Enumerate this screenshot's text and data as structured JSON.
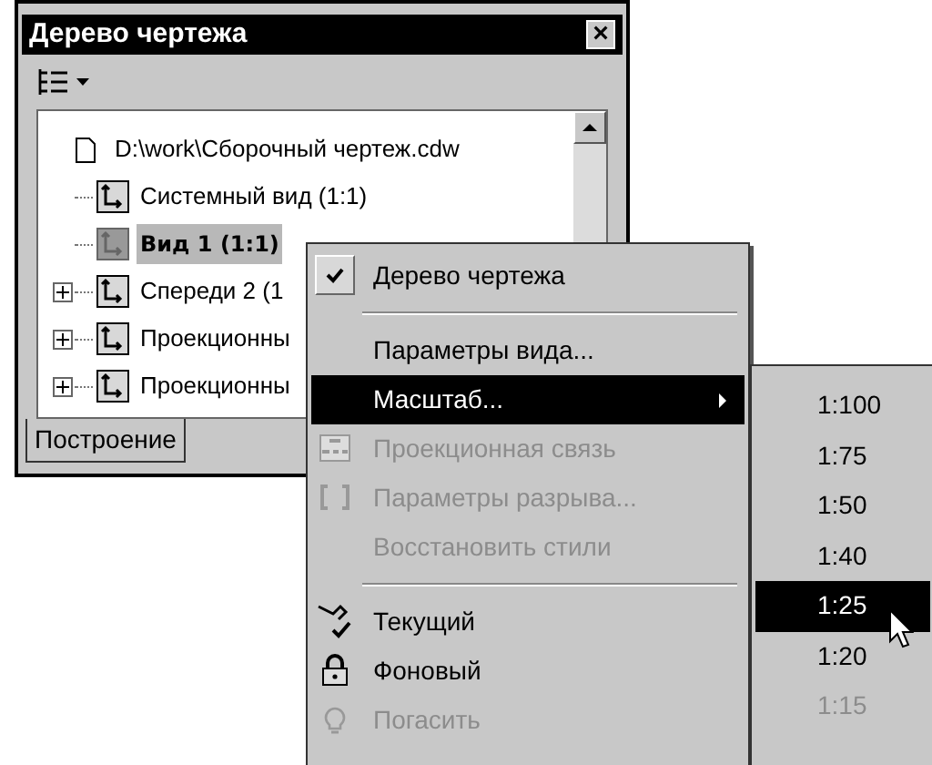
{
  "window": {
    "title": "Дерево чертежа",
    "close_label": "×"
  },
  "tree": {
    "label": "D:\\work\\Сборочный чертеж.cdw",
    "children": [
      {
        "label": "Системный вид (1:1)",
        "selected": false,
        "current": false,
        "expandable": false
      },
      {
        "label": "Вид 1 (1:1)",
        "selected": true,
        "current": true,
        "expandable": false
      },
      {
        "label": "Спереди 2 (1",
        "selected": false,
        "current": false,
        "expandable": true
      },
      {
        "label": "Проекционны",
        "selected": false,
        "current": false,
        "expandable": true
      },
      {
        "label": "Проекционны",
        "selected": false,
        "current": false,
        "expandable": true
      }
    ]
  },
  "tabs": [
    {
      "label": "Построение",
      "selected": true
    }
  ],
  "menu": [
    {
      "kind": "item",
      "label": "Дерево чертежа",
      "checked": true,
      "selected": false,
      "disabled": false,
      "submenu": false
    },
    {
      "kind": "separator"
    },
    {
      "kind": "item",
      "label": "Параметры вида...",
      "checked": false,
      "selected": false,
      "disabled": false,
      "submenu": false
    },
    {
      "kind": "item",
      "label": "Масштаб...",
      "checked": false,
      "selected": true,
      "disabled": false,
      "submenu": true
    },
    {
      "kind": "item",
      "label": "Проекционная связь",
      "checked": false,
      "selected": false,
      "disabled": true,
      "submenu": false
    },
    {
      "kind": "item",
      "label": "Параметры разрыва...",
      "checked": false,
      "selected": false,
      "disabled": true,
      "submenu": false
    },
    {
      "kind": "item",
      "label": "Восстановить стили",
      "checked": false,
      "selected": false,
      "disabled": true,
      "submenu": false
    },
    {
      "kind": "separator"
    },
    {
      "kind": "item",
      "label": "Текущий",
      "checked": false,
      "selected": false,
      "disabled": false,
      "submenu": false
    },
    {
      "kind": "item",
      "label": "Фоновый",
      "checked": false,
      "selected": false,
      "disabled": false,
      "submenu": false
    },
    {
      "kind": "item",
      "label": "Погасить",
      "checked": false,
      "selected": false,
      "disabled": true,
      "submenu": false
    }
  ],
  "submenu": [
    {
      "label": "1:100",
      "selected": false,
      "disabled": false
    },
    {
      "label": "1:75",
      "selected": false,
      "disabled": false
    },
    {
      "label": "1:50",
      "selected": false,
      "disabled": false
    },
    {
      "label": "1:40",
      "selected": false,
      "disabled": false
    },
    {
      "label": "1:25",
      "selected": true,
      "disabled": false
    },
    {
      "label": "1:20",
      "selected": false,
      "disabled": false
    },
    {
      "label": "1:15",
      "selected": false,
      "disabled": true
    }
  ]
}
